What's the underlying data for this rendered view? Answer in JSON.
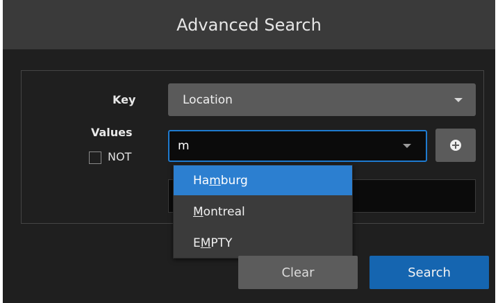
{
  "dialog": {
    "title": "Advanced Search"
  },
  "form": {
    "key_label": "Key",
    "key_value": "Location",
    "values_label": "Values",
    "not_label": "NOT",
    "not_checked": false,
    "value_input": "m"
  },
  "dropdown": {
    "options": [
      {
        "before": "Ha",
        "match": "m",
        "after": "burg",
        "highlighted": true
      },
      {
        "before": "",
        "match": "M",
        "after": "ontreal",
        "highlighted": false
      },
      {
        "before": "E",
        "match": "M",
        "after": "PTY",
        "highlighted": false
      }
    ]
  },
  "buttons": {
    "clear": "Clear",
    "search": "Search"
  },
  "colors": {
    "accent": "#1e7bd0",
    "highlight": "#2c7fd0",
    "search_button": "#1565b0"
  },
  "icons": {
    "add": "plus-circle-icon",
    "dropdown": "caret-down-icon"
  }
}
